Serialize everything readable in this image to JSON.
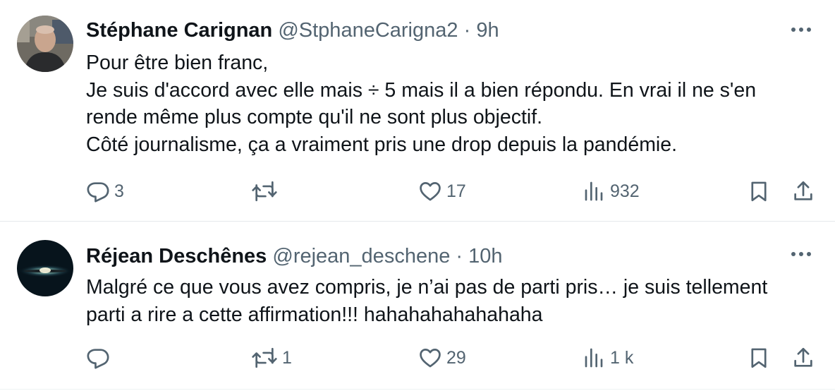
{
  "tweets": [
    {
      "name": "Stéphane Carignan",
      "handle": "@StphaneCarigna2",
      "separator": "·",
      "time": "9h",
      "text_lines": [
        "Pour être bien franc,",
        "Je suis d'accord avec elle mais ÷ 5 mais il a bien répondu. En vrai il ne s'en",
        "rende même plus compte qu'il ne sont plus objectif.",
        "Côté journalisme, ça a vraiment pris une drop depuis la pandémie."
      ],
      "replies": "3",
      "retweets": "",
      "likes": "17",
      "views": "932"
    },
    {
      "name": "Réjean Deschênes",
      "handle": "@rejean_deschene",
      "separator": "·",
      "time": "10h",
      "text_lines": [
        "Malgré ce que vous avez compris, je n’ai pas de parti pris… je suis tellement",
        "parti a rire a cette affirmation!!! hahahahahahahaha"
      ],
      "replies": "",
      "retweets": "1",
      "likes": "29",
      "views": "1 k"
    }
  ],
  "icons": {
    "reply": "reply-icon",
    "retweet": "retweet-icon",
    "like": "heart-icon",
    "views": "views-chart-icon",
    "bookmark": "bookmark-icon",
    "share": "share-icon",
    "more": "more-dots-icon"
  },
  "colors": {
    "text": "#0f1419",
    "secondary": "#536471",
    "divider": "#eff3f4"
  }
}
